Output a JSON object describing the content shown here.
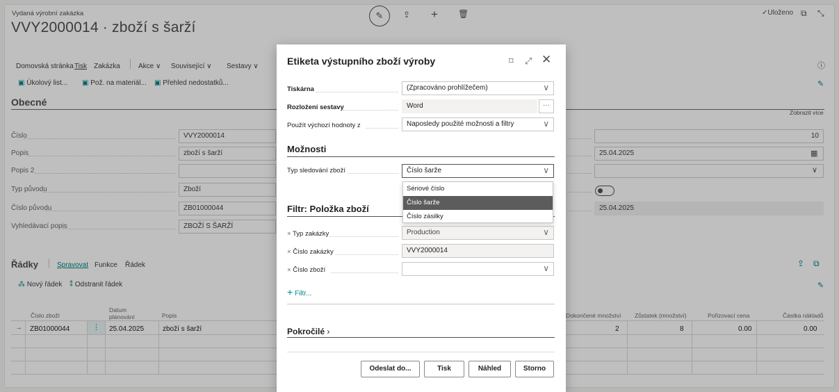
{
  "page": {
    "caption": "Vydaná výrobní zakázka",
    "title": "VVY2000014 · zboží s šarží",
    "saved_label": "✓Uloženo",
    "nav": [
      "Domovská stránka",
      "Tisk",
      "Zakázka",
      "Akce ∨",
      "Související ∨",
      "Sestavy ∨"
    ],
    "actions": [
      "Úkolový list...",
      "Pož. na materiál...",
      "Přehled nedostatků..."
    ]
  },
  "general": {
    "heading": "Obecné",
    "show_more": "Zobrazit více",
    "fields": [
      {
        "label": "Číslo",
        "value": "VVY2000014"
      },
      {
        "label": "Popis",
        "value": "zboží s šarží"
      },
      {
        "label": "Popis 2",
        "value": ""
      },
      {
        "label": "Typ původu",
        "value": "Zboží"
      },
      {
        "label": "Číslo původu",
        "value": "ZB01000044"
      },
      {
        "label": "Vyhledávací popis",
        "value": "ZBOŽÍ S ŠARŽÍ"
      }
    ],
    "right_fields": [
      "10",
      "25.04.2025",
      "",
      "",
      "25.04.2025"
    ]
  },
  "lines": {
    "heading": "Řádky",
    "tabs": [
      "Spravovat",
      "Funkce",
      "Řádek"
    ],
    "actions": [
      "Nový řádek",
      "Odstranit řádek"
    ],
    "columns": [
      "Číslo zboží",
      "Datum plánování",
      "Popis",
      "Dokončené množství",
      "Zůstatek (množství)",
      "Pořizovací cena",
      "Částka nákladů"
    ],
    "rows": [
      {
        "item": "ZB01000044",
        "date": "25.04.2025",
        "desc": "zboží s šarží",
        "done": "2",
        "rest": "8",
        "cost": "0.00",
        "amount": "0.00"
      }
    ]
  },
  "dialog": {
    "title": "Etiketa výstupního zboží výroby",
    "printer_label": "Tiskárna",
    "printer_value": "(Zpracováno prohlížečem)",
    "layout_label": "Rozložení sestavy",
    "layout_value": "Word",
    "defaults_label": "Použít výchozí hodnoty z",
    "defaults_value": "Naposledy použité možnosti a filtry",
    "options_heading": "Možnosti",
    "tracking_label": "Typ sledování zboží",
    "tracking_value": "Číslo šarže",
    "tracking_options": [
      "Sériové číslo",
      "Číslo šarže",
      "Číslo zásilky"
    ],
    "filter_heading": "Filtr: Položka zboží",
    "filters": [
      {
        "label": "Typ zakázky",
        "value": "Production"
      },
      {
        "label": "Číslo zakázky",
        "value": "VVY2000014"
      },
      {
        "label": "Číslo zboží",
        "value": ""
      }
    ],
    "add_filter": "Filtr...",
    "advanced": "Pokročilé",
    "buttons": [
      "Odeslat do...",
      "Tisk",
      "Náhled",
      "Storno"
    ]
  }
}
